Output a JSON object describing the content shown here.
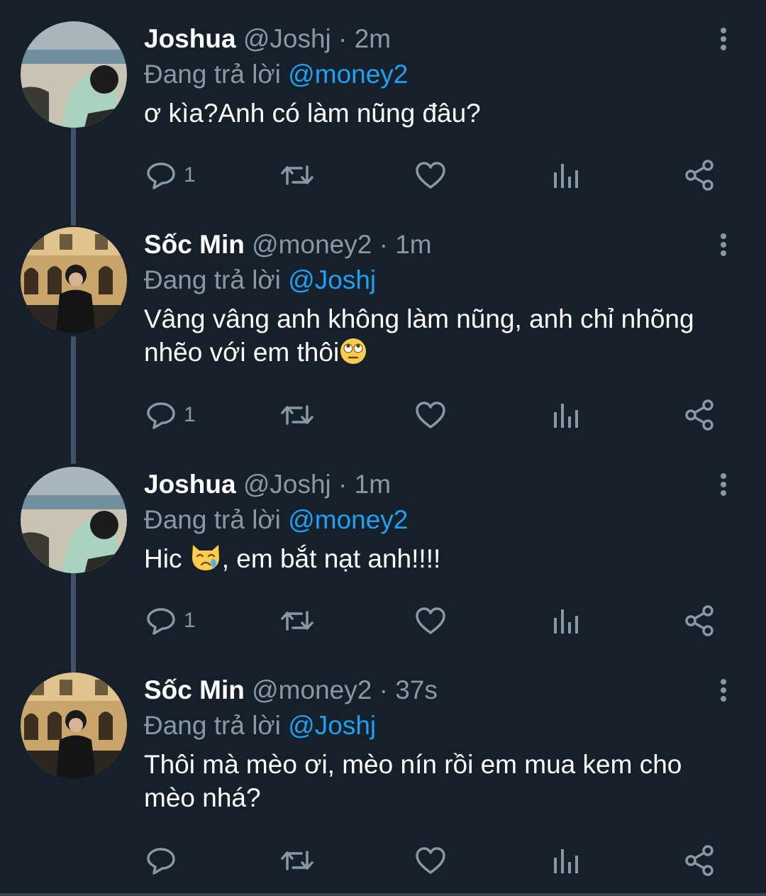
{
  "tweets": [
    {
      "name": "Joshua",
      "handle": "@Joshj",
      "separator": "·",
      "time": "2m",
      "replying_prefix": "Đang trả lời",
      "replying_to": "@money2",
      "text": "ơ kìa?Anh có làm nũng đâu?",
      "reply_count": "1",
      "avatar": "joshua-avatar"
    },
    {
      "name": "Sốc Min",
      "handle": "@money2",
      "separator": "·",
      "time": "1m",
      "replying_prefix": "Đang trả lời",
      "replying_to": "@Joshj",
      "text": "Vâng vâng anh không làm nũng, anh chỉ nhõng nhẽo với em thôi",
      "emoji": "face-with-rolling-eyes",
      "reply_count": "1",
      "avatar": "socmin-avatar"
    },
    {
      "name": "Joshua",
      "handle": "@Joshj",
      "separator": "·",
      "time": "1m",
      "replying_prefix": "Đang trả lời",
      "replying_to": "@money2",
      "text_before": "Hic ",
      "emoji": "crying-cat-face",
      "text_after": ", em bắt nạt anh!!!!",
      "reply_count": "1",
      "avatar": "joshua-avatar"
    },
    {
      "name": "Sốc Min",
      "handle": "@money2",
      "separator": "·",
      "time": "37s",
      "replying_prefix": "Đang trả lời",
      "replying_to": "@Joshj",
      "text": "Thôi mà mèo ơi, mèo nín rồi em mua kem cho mèo nhá?",
      "reply_count": "",
      "avatar": "socmin-avatar"
    }
  ],
  "colors": {
    "background": "#15202b",
    "secondary_text": "#8899a6",
    "mention": "#1da1f2",
    "thread_line": "#3d5466"
  }
}
